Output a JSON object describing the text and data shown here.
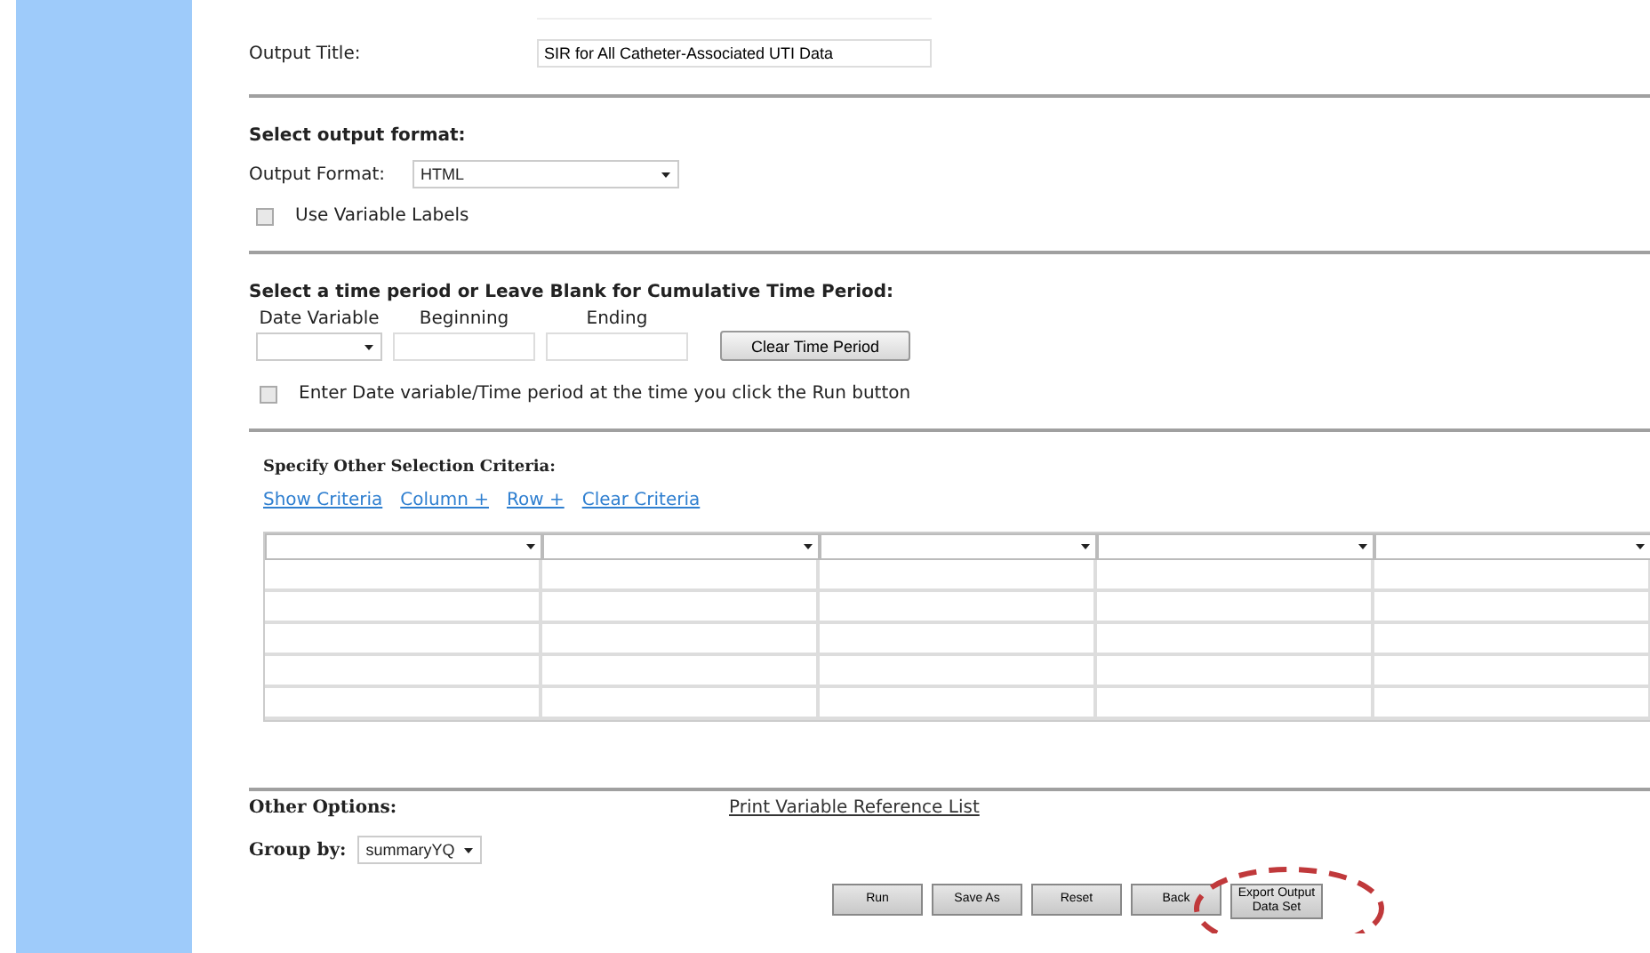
{
  "output_title": {
    "label": "Output Title:",
    "value": "SIR for All Catheter-Associated UTI Data"
  },
  "output_format": {
    "heading": "Select output format:",
    "label": "Output Format:",
    "value": "HTML",
    "use_labels": {
      "label": "Use Variable Labels",
      "checked": false
    }
  },
  "time_period": {
    "heading": "Select a time period or Leave Blank for Cumulative Time Period:",
    "columns": [
      "Date Variable",
      "Beginning",
      "Ending"
    ],
    "clear_button": "Clear Time Period",
    "enter_later": {
      "label": "Enter Date variable/Time period at the time you click the Run button",
      "checked": false
    }
  },
  "criteria": {
    "heading": "Specify Other Selection Criteria:",
    "links": [
      "Show Criteria",
      "Column +",
      "Row +",
      "Clear Criteria"
    ]
  },
  "other_options": {
    "heading": "Other Options:",
    "link": "Print Variable Reference List",
    "group_label": "Group by:",
    "group_value": "summaryYQ"
  },
  "buttons": [
    {
      "label": "Run",
      "highlighted": false
    },
    {
      "label": "Save As",
      "highlighted": false
    },
    {
      "label": "Reset",
      "highlighted": false
    },
    {
      "label": "Back",
      "highlighted": false
    },
    {
      "label": "Export Output Data Set",
      "highlighted": true
    }
  ]
}
